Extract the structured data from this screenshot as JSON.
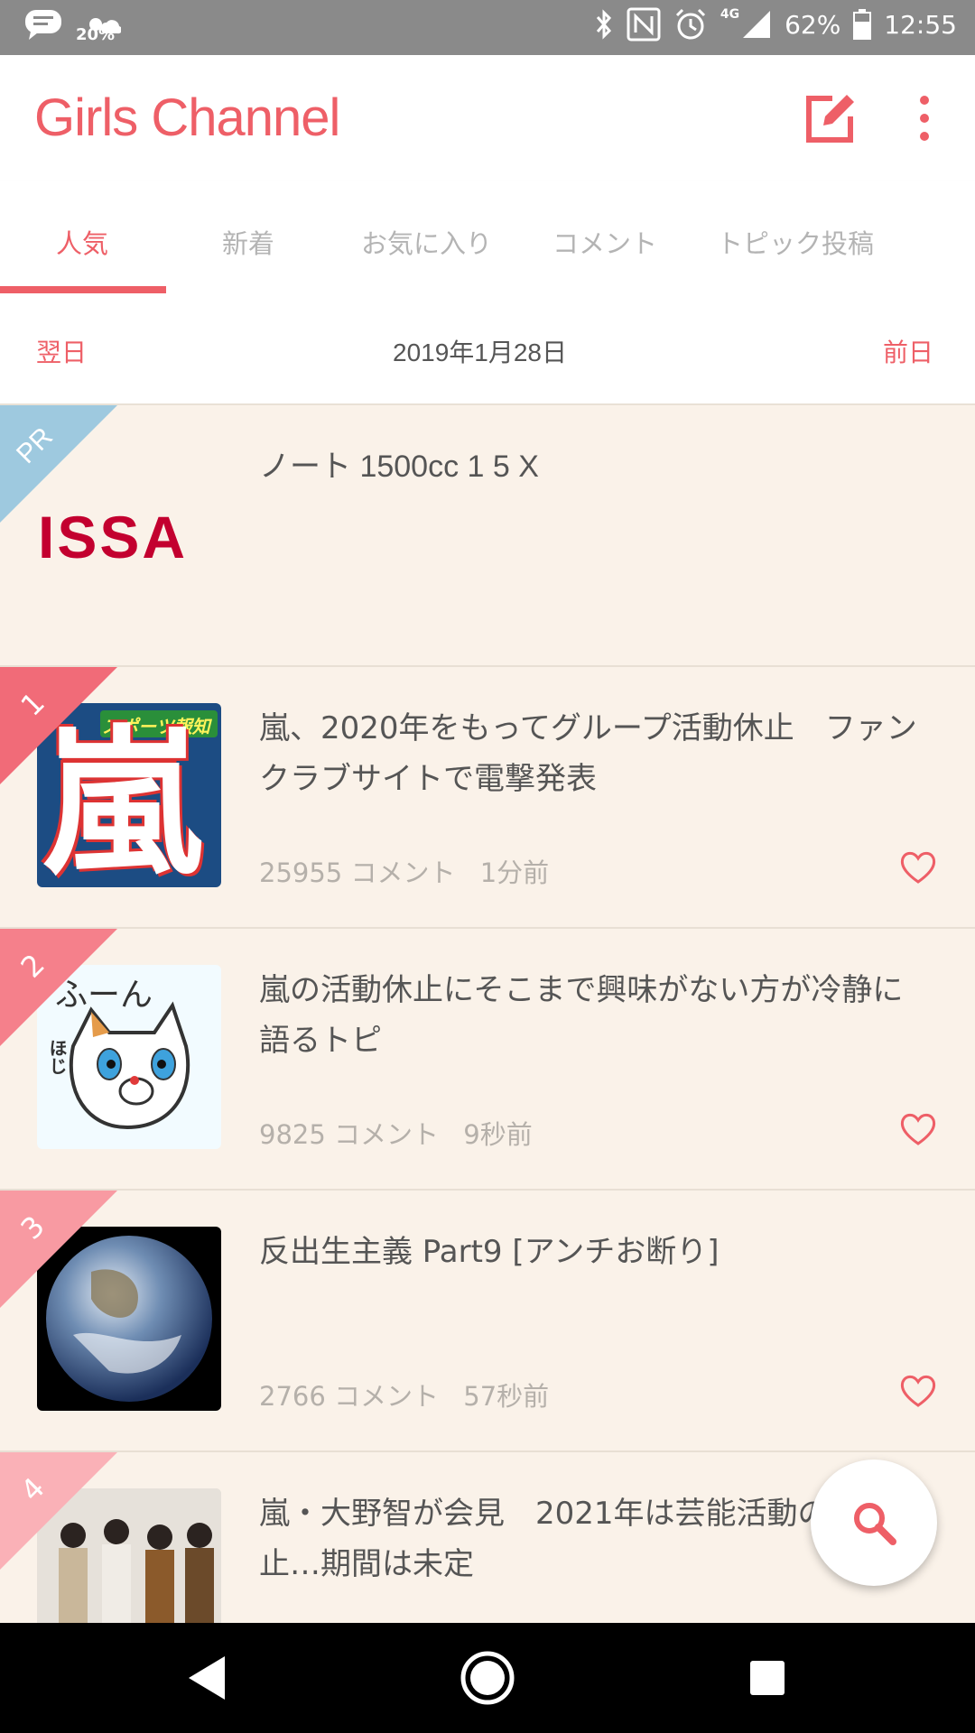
{
  "status_bar": {
    "left_battery_pct": "20%",
    "signal_label": "4G",
    "battery_pct": "62%",
    "time": "12:55"
  },
  "app": {
    "title": "Girls Channel",
    "accent": "#ee5f67"
  },
  "tabs": [
    {
      "label": "人気"
    },
    {
      "label": "新着"
    },
    {
      "label": "お気に入り"
    },
    {
      "label": "コメント"
    },
    {
      "label": "トピック投稿"
    }
  ],
  "date_nav": {
    "next_label": "翌日",
    "date": "2019年1月28日",
    "prev_label": "前日"
  },
  "pr_item": {
    "badge": "PR",
    "logo_text": "ISSA",
    "title": "ノート 1500cc 1 5 X"
  },
  "topics": [
    {
      "rank": "1",
      "thumb_text": "嵐",
      "thumb_sub": "スポーツ報知",
      "title": "嵐、2020年をもってグループ活動休止　ファンクラブサイトで電撃発表",
      "comments": "25955 コメント",
      "time": "1分前"
    },
    {
      "rank": "2",
      "thumb_text": "ふーん",
      "thumb_sub": "ほじ",
      "title": "嵐の活動休止にそこまで興味がない方が冷静に語るトピ",
      "comments": "9825 コメント",
      "time": "9秒前"
    },
    {
      "rank": "3",
      "thumb_text": "",
      "thumb_sub": "",
      "title": " 反出生主義 Part9 [アンチお断り]",
      "comments": "2766 コメント",
      "time": "57秒前"
    },
    {
      "rank": "4",
      "thumb_text": "",
      "thumb_sub": "",
      "title": "嵐・大野智が会見　2021年は芸能活動のを休止…期間は未定",
      "comments": "",
      "time": ""
    }
  ]
}
